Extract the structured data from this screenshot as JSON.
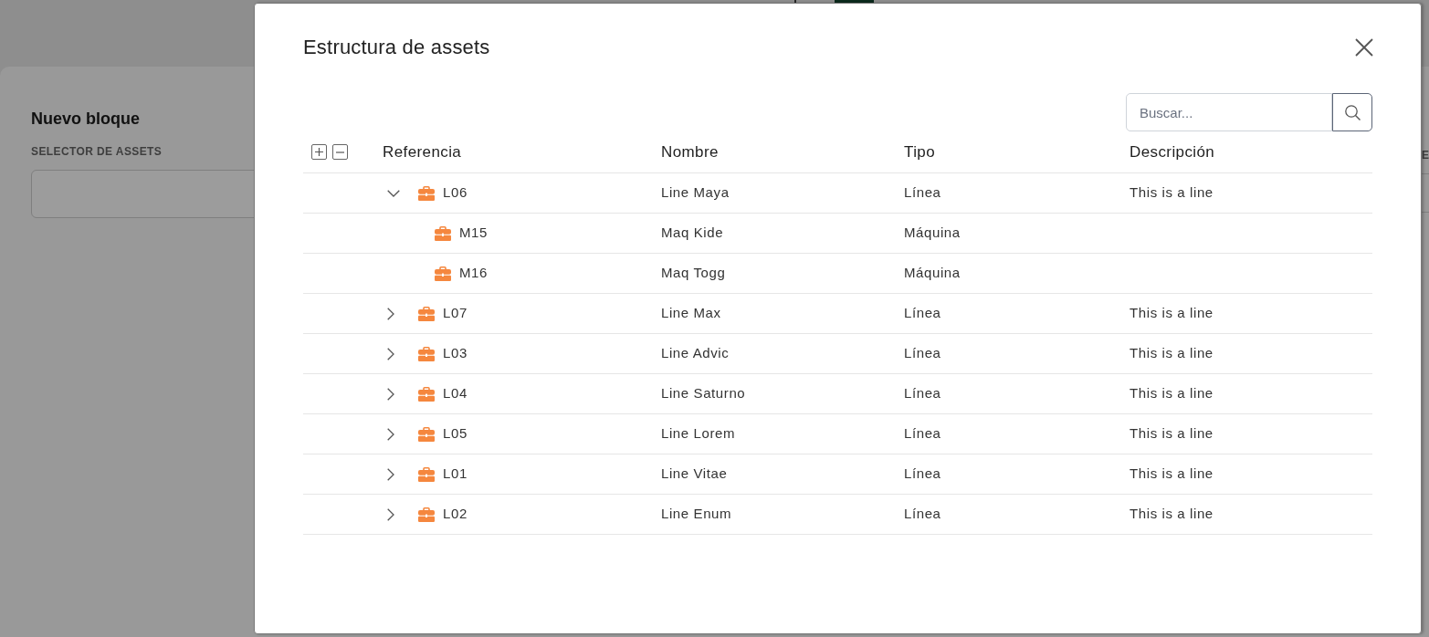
{
  "background": {
    "title": "Nuevo bloque",
    "field_label": "SELECTOR DE ASSETS",
    "edge_label": "E"
  },
  "dialog": {
    "title": "Estructura de assets",
    "search": {
      "placeholder": "Buscar..."
    },
    "table": {
      "columns": [
        "Referencia",
        "Nombre",
        "Tipo",
        "Descripción"
      ],
      "rows": [
        {
          "reference": "L06",
          "name": "Line Maya",
          "type": "Línea",
          "description": "This is a line",
          "expanded": true,
          "children": [
            {
              "reference": "M15",
              "name": "Maq Kide",
              "type": "Máquina"
            },
            {
              "reference": "M16",
              "name": "Maq Togg",
              "type": "Máquina"
            }
          ]
        },
        {
          "reference": "L07",
          "name": "Line Max",
          "type": "Línea",
          "description": "This is a line",
          "expanded": false
        },
        {
          "reference": "L03",
          "name": "Line Advic",
          "type": "Línea",
          "description": "This is a line",
          "expanded": false
        },
        {
          "reference": "L04",
          "name": "Line Saturno",
          "type": "Línea",
          "description": "This is a line",
          "expanded": false
        },
        {
          "reference": "L05",
          "name": "Line Lorem",
          "type": "Línea",
          "description": "This is a line",
          "expanded": false
        },
        {
          "reference": "L01",
          "name": "Line Vitae",
          "type": "Línea",
          "description": "This is a line",
          "expanded": false
        },
        {
          "reference": "L02",
          "name": "Line Enum",
          "type": "Línea",
          "description": "This is a line",
          "expanded": false
        }
      ]
    }
  }
}
